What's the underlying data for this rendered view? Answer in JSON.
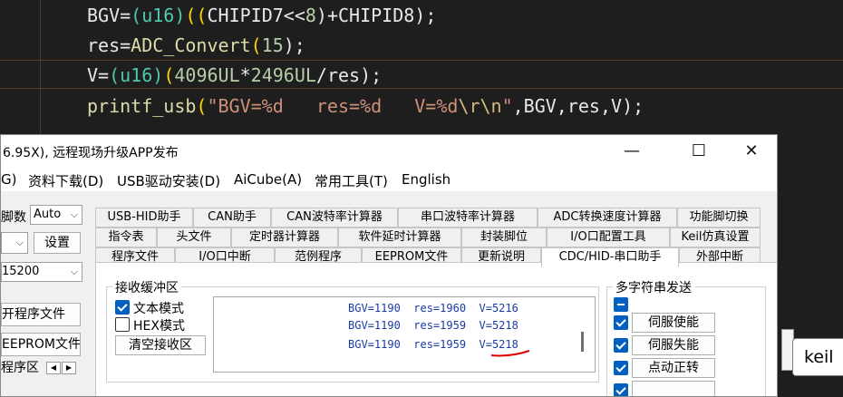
{
  "code": {
    "line1": {
      "a": "BGV=",
      "b": "(u16)",
      "c": "((",
      "d": "CHIPID7<<",
      "e": "8",
      "f": ")+CHIPID8",
      "g": ");"
    },
    "line2": {
      "a": "res=",
      "b": "ADC_Convert",
      "c": "(",
      "d": "15",
      "e": ");"
    },
    "line3": {
      "a": "V=",
      "b": "(u16)",
      "c": "(",
      "d": "4096UL",
      "e": "*",
      "f": "2496UL",
      "g": "/res",
      "h": ");"
    },
    "line4": {
      "a": "printf_usb",
      "b": "(",
      "c": "\"BGV=%d   res=%d   V=%d",
      "d": "\\r\\n",
      "e": "\"",
      "f": ",BGV,res,V",
      "g": ");"
    }
  },
  "background": {
    "keil_button": "keil"
  },
  "window": {
    "title": "6.95X), 远程现场升级APP发布",
    "controls": {
      "minimize": "—",
      "maximize": "☐",
      "close": "✕"
    }
  },
  "menu": [
    "G)",
    "资料下载(D)",
    "USB驱动安装(D)",
    "AiCube(A)",
    "常用工具(T)",
    "English"
  ],
  "left": {
    "pin_label": "脚数",
    "pin_value": "Auto",
    "set_button": "设置",
    "baud_value": "15200",
    "open_program": "开程序文件",
    "open_eeprom": "EEPROM文件",
    "program_area": "程序区"
  },
  "tabs": {
    "row1": [
      "USB-HID助手",
      "CAN助手",
      "CAN波特率计算器",
      "串口波特率计算器",
      "ADC转换速度计算器",
      "功能脚切换"
    ],
    "row2": [
      "指令表",
      "头文件",
      "定时器计算器",
      "软件延时计算器",
      "封装脚位",
      "I/O口配置工具",
      "Keil仿真设置"
    ],
    "row3": [
      "程序文件",
      "I/O口中断",
      "范例程序",
      "EEPROM文件",
      "更新说明",
      "CDC/HID-串口助手",
      "外部中断"
    ]
  },
  "recv": {
    "group_title": "接收缓冲区",
    "text_mode": "文本模式",
    "hex_mode": "HEX模式",
    "clear_button": "清空接收区",
    "lines": [
      {
        "bgv": "BGV=1190",
        "res": "res=1960",
        "v": "V=5216"
      },
      {
        "bgv": "BGV=1190",
        "res": "res=1959",
        "v": "V=5218"
      },
      {
        "bgv": "BGV=1190",
        "res": "res=1959",
        "v": "V=5218"
      }
    ]
  },
  "multi": {
    "group_title": "多字符串发送",
    "items": [
      "伺服使能",
      "伺服失能",
      "点动正转"
    ]
  },
  "colors": {
    "accent": "#0060c0",
    "recv_text": "#1a3aa8",
    "annotation": "#e00000"
  }
}
